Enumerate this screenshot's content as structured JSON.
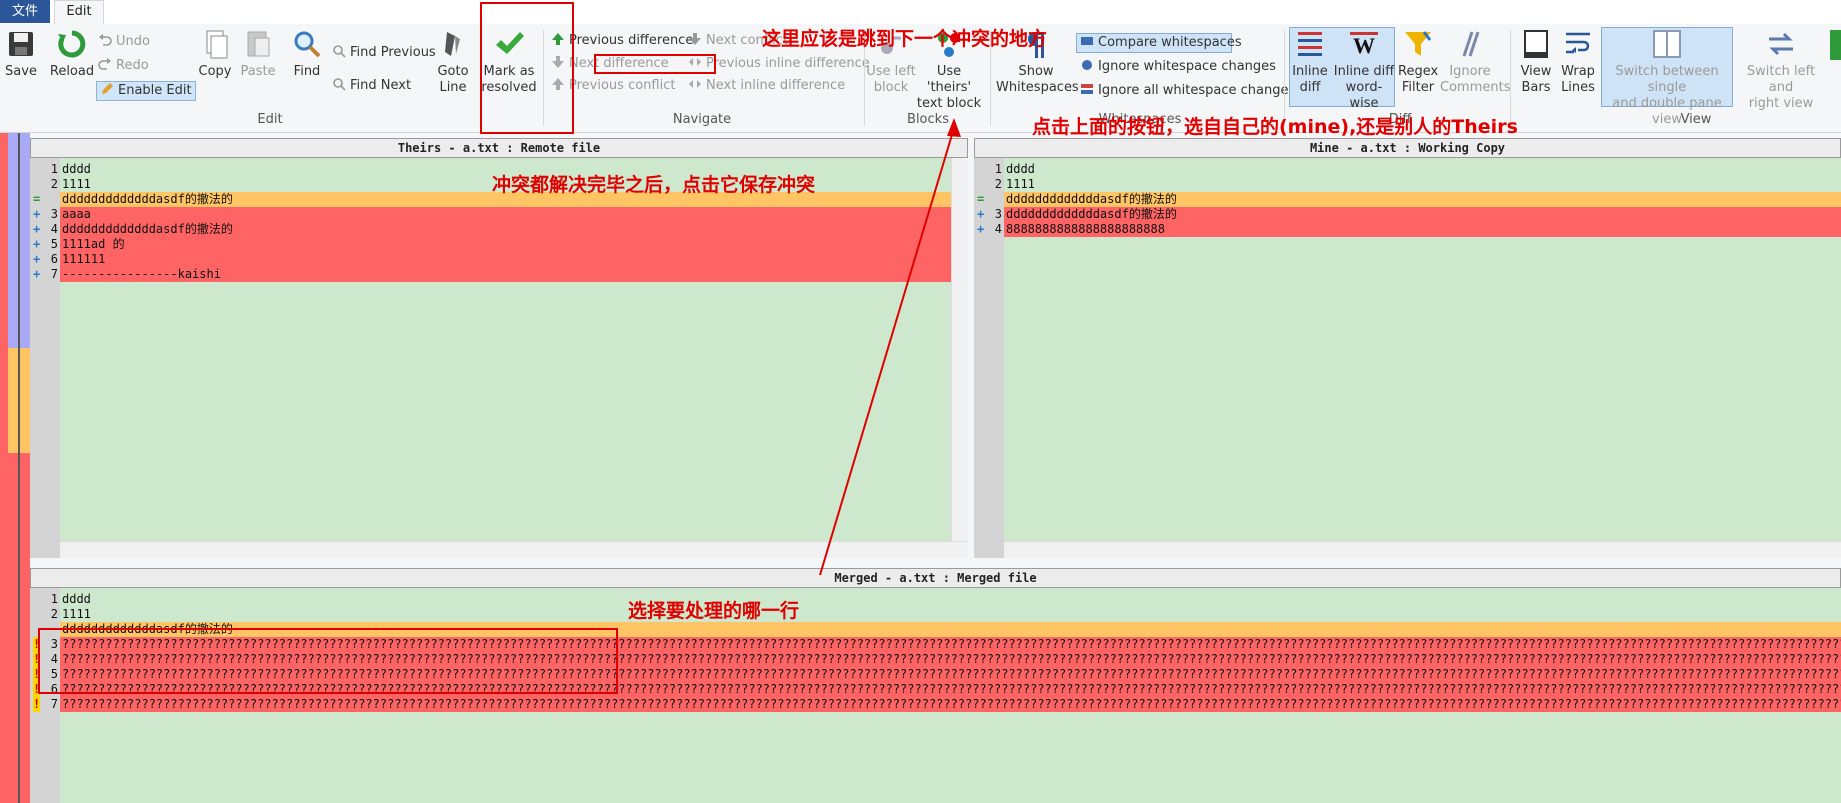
{
  "menu": {
    "file": "文件",
    "edit": "Edit"
  },
  "ribbon": {
    "save": "Save",
    "reload": "Reload",
    "undo": "Undo",
    "redo": "Redo",
    "enable_edit": "Enable Edit",
    "copy": "Copy",
    "paste": "Paste",
    "find": "Find",
    "find_previous": "Find Previous",
    "find_next": "Find Next",
    "goto_line_1": "Goto",
    "goto_line_2": "Line",
    "mark_resolved_1": "Mark as",
    "mark_resolved_2": "resolved",
    "prev_difference": "Previous difference",
    "next_difference": "Next difference",
    "prev_conflict": "Previous conflict",
    "next_conflict": "Next conflict",
    "prev_inline": "Previous inline difference",
    "next_inline": "Next inline difference",
    "use_left_1": "Use left",
    "use_left_2": "block",
    "use_theirs_1": "Use 'theirs'",
    "use_theirs_2": "text block",
    "show_ws_1": "Show",
    "show_ws_2": "Whitespaces",
    "compare_ws": "Compare whitespaces",
    "ignore_ws_changes": "Ignore whitespace changes",
    "ignore_all_ws": "Ignore all whitespace changes",
    "inline_diff_1": "Inline",
    "inline_diff_2": "diff",
    "inline_word_1": "Inline diff",
    "inline_word_2": "word-wise",
    "regex_1": "Regex",
    "regex_2": "Filter",
    "ignore_comments_1": "Ignore",
    "ignore_comments_2": "Comments",
    "view_bars_1": "View",
    "view_bars_2": "Bars",
    "wrap_1": "Wrap",
    "wrap_2": "Lines",
    "switch_pane_1": "Switch between single",
    "switch_pane_2": "and double pane view",
    "switch_lr_1": "Switch left and",
    "switch_lr_2": "right view",
    "groups": {
      "edit": "Edit",
      "navigate": "Navigate",
      "blocks": "Blocks",
      "whitespaces": "Whitespaces",
      "diff": "Diff",
      "view": "View"
    }
  },
  "panes": {
    "theirs_title": "Theirs - a.txt : Remote file",
    "mine_title": "Mine - a.txt : Working Copy",
    "merged_title": "Merged - a.txt : Merged file"
  },
  "theirs_lines": [
    {
      "mark": "",
      "num": "1",
      "text": "dddd",
      "kind": "normal"
    },
    {
      "mark": "",
      "num": "2",
      "text": "1111",
      "kind": "normal"
    },
    {
      "mark": "=",
      "num": "",
      "text": "dddddddddddddasdf的撤法的",
      "kind": "orange"
    },
    {
      "mark": "+",
      "num": "3",
      "text": "aaaa",
      "kind": "red"
    },
    {
      "mark": "+",
      "num": "4",
      "text": "dddddddddddddasdf的撤法的",
      "kind": "red"
    },
    {
      "mark": "+",
      "num": "5",
      "text": "1111ad 的",
      "kind": "red"
    },
    {
      "mark": "+",
      "num": "6",
      "text": "111111",
      "kind": "red"
    },
    {
      "mark": "+",
      "num": "7",
      "text": "----------------kaishi",
      "kind": "red"
    }
  ],
  "mine_lines": [
    {
      "mark": "",
      "num": "1",
      "text": "dddd",
      "kind": "normal"
    },
    {
      "mark": "",
      "num": "2",
      "text": "1111",
      "kind": "normal"
    },
    {
      "mark": "=",
      "num": "",
      "text": "dddddddddddddasdf的撤法的",
      "kind": "orange"
    },
    {
      "mark": "+",
      "num": "3",
      "text": "dddddddddddddasdf的撤法的",
      "kind": "red"
    },
    {
      "mark": "+",
      "num": "4",
      "text": "8888888888888888888888",
      "kind": "red"
    }
  ],
  "merged_lines": [
    {
      "mark": "",
      "num": "1",
      "text": "dddd",
      "kind": "normal"
    },
    {
      "mark": "",
      "num": "2",
      "text": "1111",
      "kind": "normal"
    },
    {
      "mark": "",
      "num": "",
      "text": "dddddddddddddasdf的撤法的",
      "kind": "orange"
    },
    {
      "mark": "!",
      "num": "3",
      "text": "??????????????????????????????????????????????????????????????????????????????????????????????????????????????????????????????????????????????????????????????????????????????????????????????????????????????????????????????????????????????????????????????????????????",
      "kind": "red"
    },
    {
      "mark": "!",
      "num": "4",
      "text": "??????????????????????????????????????????????????????????????????????????????????????????????????????????????????????????????????????????????????????????????????????????????????????????????????????????????????????????????????????????????????????????????????????????",
      "kind": "red"
    },
    {
      "mark": "!",
      "num": "5",
      "text": "??????????????????????????????????????????????????????????????????????????????????????????????????????????????????????????????????????????????????????????????????????????????????????????????????????????????????????????????????????????????????????????????????????????",
      "kind": "red"
    },
    {
      "mark": "!",
      "num": "6",
      "text": "??????????????????????????????????????????????????????????????????????????????????????????????????????????????????????????????????????????????????????????????????????????????????????????????????????????????????????????????????????????????????????????????????????????",
      "kind": "red"
    },
    {
      "mark": "!",
      "num": "7",
      "text": "??????????????????????????????????????????????????????????????????????????????????????????????????????????????????????????????????????????????????????????????????????????????????????????????????????????????????????????????????????????????????????????????????????????",
      "kind": "red"
    }
  ],
  "annotations": {
    "next_conflict_note": "这里应该是跳到下一个冲突的地方",
    "choose_note": "点击上面的按钮，选自自己的(mine),还是别人的Theirs",
    "save_note": "冲突都解决完毕之后，点击它保存冲突",
    "select_line_note": "选择要处理的哪一行"
  },
  "colors": {
    "conflict_red": "#ff6464",
    "equal_orange": "#ffc564",
    "unchanged_green": "#cde8cd",
    "annotation_red": "#e00000",
    "accent_blue": "#2b579a"
  }
}
